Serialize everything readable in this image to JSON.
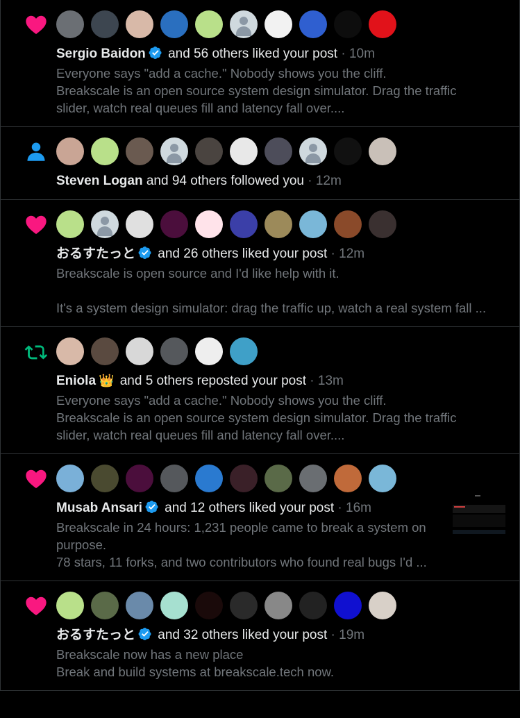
{
  "colors": {
    "like": "#f91880",
    "follow": "#1d9bf0",
    "repost": "#00ba7c",
    "verified": "#1d9bf0",
    "muted": "#71767b",
    "divider": "#2f3336"
  },
  "notifications": [
    {
      "type": "like",
      "icon": "heart-icon",
      "name": "Sergio Baidon",
      "badge": "verified",
      "rest": " and 56 others liked your post",
      "time": " · 10m",
      "preview": [
        "Everyone says \"add a cache.\" Nobody shows you the cliff.",
        "Breakscale is an open source system design simulator. Drag the traffic",
        "slider, watch real queues fill and latency fall over...."
      ],
      "avatars": [
        "#6b6f74",
        "#3d4650",
        "#d8b9a8",
        "#2a6fbf",
        "#b9e08a",
        "default",
        "#f2f2f2",
        "#2f5fd0",
        "#0d0d0d",
        "#e1121a"
      ]
    },
    {
      "type": "follow",
      "icon": "person-icon",
      "name": "Steven Logan",
      "badge": "",
      "rest": " and 94 others followed you",
      "time": " · 12m",
      "preview": [],
      "avatars": [
        "#c9a595",
        "#b9e08a",
        "#6a5a50",
        "default",
        "#4a4440",
        "#e8e8e8",
        "#4d4d5a",
        "default",
        "#111111",
        "#c9c0b8"
      ]
    },
    {
      "type": "like",
      "icon": "heart-icon",
      "name": "おるすたっと",
      "badge": "verified",
      "rest": " and 26 others liked your post",
      "time": " · 12m",
      "preview": [
        "Breakscale is open source and I'd like help with it.",
        "",
        "It's a system design simulator: drag the traffic up, watch a real system fall ..."
      ],
      "avatars": [
        "#b9e08a",
        "default",
        "#e0e0e0",
        "#4b0e3c",
        "#ffe3ea",
        "#3b3fa8",
        "#9c8a5a",
        "#7ab7d8",
        "#8a4a2a",
        "#3a3030"
      ]
    },
    {
      "type": "repost",
      "icon": "repost-icon",
      "name": "Eniola",
      "badge": "crown",
      "rest": " and 5 others reposted your post",
      "time": " · 13m",
      "preview": [
        "Everyone says \"add a cache.\" Nobody shows you the cliff.",
        "Breakscale is an open source system design simulator. Drag the traffic",
        "slider, watch real queues fill and latency fall over...."
      ],
      "avatars": [
        "#d8b9a8",
        "#5a4a40",
        "#d8d8d8",
        "#55585c",
        "#eeeeee",
        "#3fa0c8"
      ]
    },
    {
      "type": "like",
      "icon": "heart-icon",
      "name": "Musab Ansari",
      "badge": "verified",
      "rest": " and 12 others liked your post",
      "time": " · 16m",
      "preview": [
        "Breakscale in 24 hours: 1,231 people came to break a system on",
        "purpose.",
        "78 stars, 11 forks, and two contributors who found real bugs I'd ..."
      ],
      "avatars": [
        "#7ab0d8",
        "#4a4a30",
        "#4b0e3c",
        "#55585c",
        "#2a7ad0",
        "#3a2028",
        "#5a6a48",
        "#6a6e72",
        "#c06a3a",
        "#7ab7d8"
      ]
    },
    {
      "type": "like",
      "icon": "heart-icon",
      "name": "おるすたっと",
      "badge": "verified",
      "rest": " and 32 others liked your post",
      "time": " · 19m",
      "preview": [
        "Breakscale now has a new place",
        "Break and build systems at breakscale.tech now."
      ],
      "avatars": [
        "#b9e08a",
        "#5a6a48",
        "#6a8aaa",
        "#a6e0d0",
        "#1a0a0a",
        "#2a2a2a",
        "#888888",
        "#222222",
        "#1010d0",
        "#d8d0c8"
      ]
    }
  ]
}
